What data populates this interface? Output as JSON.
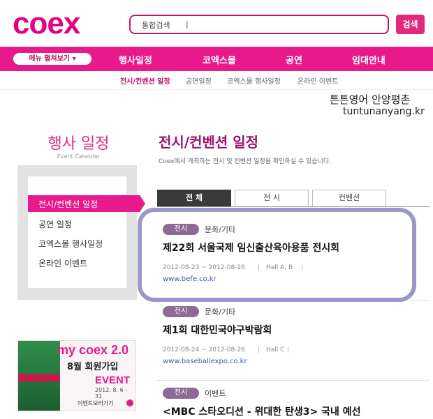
{
  "header": {
    "logo": "coex",
    "search_label": "통합검색",
    "search_caret": "|",
    "search_button": "검색"
  },
  "mainnav": {
    "menu_button": "메뉴 펼쳐보기 ▾",
    "items": [
      "행사일정",
      "코엑스몰",
      "공연",
      "임대안내"
    ]
  },
  "subnav": {
    "items": [
      "전시/컨벤션 일정",
      "공연일정",
      "코엑스몰 행사일정",
      "온라인 이벤트"
    ]
  },
  "watermark": {
    "line1": "튼튼영어 안양평촌",
    "line2": "tuntunanyang.kr"
  },
  "sidebar": {
    "title": "행사 일정",
    "subtitle": "Event Calendar",
    "items": [
      "전시/컨벤션 일정",
      "공연 일정",
      "코엑스몰 행사일정",
      "온라인 이벤트"
    ]
  },
  "banner": {
    "line1": "my coex 2.0",
    "line2": "8월 회원가입",
    "line3": "EVENT",
    "line4": "2012. 8. 6 - 31",
    "line5": "이벤트보러가기"
  },
  "main": {
    "title": "전시/컨벤션 일정",
    "description": "Coex에서 개최하는 전시 및 컨벤션 일정을 확인하실 수 있습니다.",
    "tabs": [
      "전 체",
      "전 시",
      "컨벤션"
    ],
    "events": [
      {
        "badge": "전시",
        "category": "문화/기타",
        "title": "제22회 서울국제 임신출산육아용품 전시회",
        "date": "2012-08-23 ~ 2012-08-26",
        "hall": "Hall A, B",
        "url": "www.befe.co.kr"
      },
      {
        "badge": "전시",
        "category": "문화/기타",
        "title": "제1회 대한민국야구박람회",
        "date": "2012-08-24 ~ 2012-08-26",
        "hall": "Hall C",
        "url": "www.baseballexpo.co.kr"
      },
      {
        "badge": "전시",
        "category": "이벤트",
        "title": "<MBC 스타오디션 - 위대한 탄생3> 국내 예선"
      }
    ]
  },
  "colors": {
    "brand": "#e8198b",
    "title": "#a0126e",
    "highlight": "#9a97c9"
  }
}
